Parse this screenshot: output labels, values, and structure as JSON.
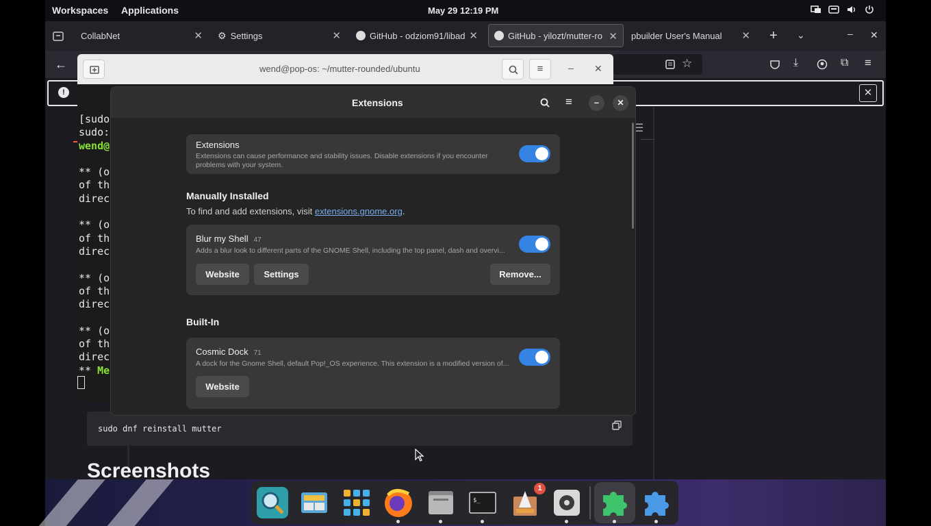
{
  "topbar": {
    "workspaces": "Workspaces",
    "applications": "Applications",
    "clock": "May 29  12:19 PM"
  },
  "browser": {
    "tabs": [
      {
        "label": "CollabNet"
      },
      {
        "label": "Settings"
      },
      {
        "label": "GitHub - odziom91/libad"
      },
      {
        "label": "GitHub - yilozt/mutter-ro"
      },
      {
        "label": "pbuilder User's Manual"
      }
    ],
    "code_snippet": "sudo dnf reinstall mutter",
    "heading": "Screenshots"
  },
  "terminal": {
    "title": "wend@pop-os: ~/mutter-rounded/ubuntu",
    "lines": [
      "[sudo",
      "sudo:",
      "wend@",
      "",
      "** (o",
      "of th",
      "direc",
      "",
      "** (o",
      "of th",
      "direc",
      "",
      "** (o",
      "of th",
      "direc",
      "",
      "** (o",
      "of th",
      "direc",
      "** Me"
    ]
  },
  "extensions": {
    "title": "Extensions",
    "master": {
      "title": "Extensions",
      "desc": "Extensions can cause performance and stability issues. Disable extensions if you encounter problems with your system."
    },
    "manual_heading": "Manually Installed",
    "manual_hint_prefix": "To find and add extensions, visit ",
    "manual_hint_link": "extensions.gnome.org",
    "manual_hint_suffix": ".",
    "blur": {
      "title": "Blur my Shell",
      "version": "47",
      "desc": "Adds a blur look to different parts of the GNOME Shell, including the top panel, dash and overvi...",
      "website": "Website",
      "settings": "Settings",
      "remove": "Remove..."
    },
    "builtin_heading": "Built-In",
    "dock": {
      "title": "Cosmic Dock",
      "version": "71",
      "desc": "A dock for the Gnome Shell, default Pop!_OS experience. This extension is a modified version of...",
      "website": "Website"
    }
  },
  "dock": {
    "badge": "1"
  },
  "colors": {
    "accent": "#3584e4",
    "link": "#78aeed"
  }
}
